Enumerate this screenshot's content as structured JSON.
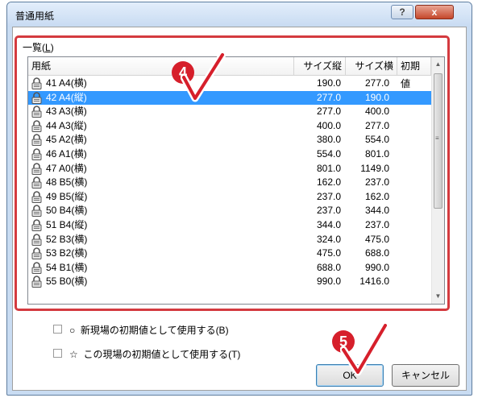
{
  "dialog": {
    "title": "普通用紙",
    "help_label": "?",
    "close_label": "x"
  },
  "list": {
    "group_label_prefix": "一覧(",
    "group_label_key": "L",
    "group_label_suffix": ")",
    "columns": [
      "用紙",
      "サイズ縦",
      "サイズ横",
      "初期値"
    ],
    "rows": [
      {
        "name": "41 A4(横)",
        "h": "190.0",
        "w": "277.0",
        "default": ""
      },
      {
        "name": "42 A4(縦)",
        "h": "277.0",
        "w": "190.0",
        "default": ""
      },
      {
        "name": "43 A3(横)",
        "h": "277.0",
        "w": "400.0",
        "default": ""
      },
      {
        "name": "44 A3(縦)",
        "h": "400.0",
        "w": "277.0",
        "default": ""
      },
      {
        "name": "45 A2(横)",
        "h": "380.0",
        "w": "554.0",
        "default": ""
      },
      {
        "name": "46 A1(横)",
        "h": "554.0",
        "w": "801.0",
        "default": ""
      },
      {
        "name": "47 A0(横)",
        "h": "801.0",
        "w": "1149.0",
        "default": ""
      },
      {
        "name": "48 B5(横)",
        "h": "162.0",
        "w": "237.0",
        "default": ""
      },
      {
        "name": "49 B5(縦)",
        "h": "237.0",
        "w": "162.0",
        "default": ""
      },
      {
        "name": "50 B4(横)",
        "h": "237.0",
        "w": "344.0",
        "default": ""
      },
      {
        "name": "51 B4(縦)",
        "h": "344.0",
        "w": "237.0",
        "default": ""
      },
      {
        "name": "52 B3(横)",
        "h": "324.0",
        "w": "475.0",
        "default": ""
      },
      {
        "name": "53 B2(横)",
        "h": "475.0",
        "w": "688.0",
        "default": ""
      },
      {
        "name": "54 B1(横)",
        "h": "688.0",
        "w": "990.0",
        "default": ""
      },
      {
        "name": "55 B0(横)",
        "h": "990.0",
        "w": "1416.0",
        "default": ""
      }
    ],
    "selected_index": 1,
    "scroll_up": "▲",
    "scroll_down": "▼",
    "scroll_grip": "≡"
  },
  "options": {
    "new_site_default": {
      "symbol": "○",
      "label": "新現場の初期値として使用する(B)"
    },
    "this_site_default": {
      "symbol": "☆",
      "label": "この現場の初期値として使用する(T)"
    }
  },
  "buttons": {
    "ok": "OK",
    "cancel": "キャンセル"
  },
  "annotations": {
    "step4": "4",
    "step5": "5"
  },
  "colors": {
    "highlight_border": "#d43a3f",
    "badge": "#d61f2b",
    "selection": "#3399ff"
  }
}
